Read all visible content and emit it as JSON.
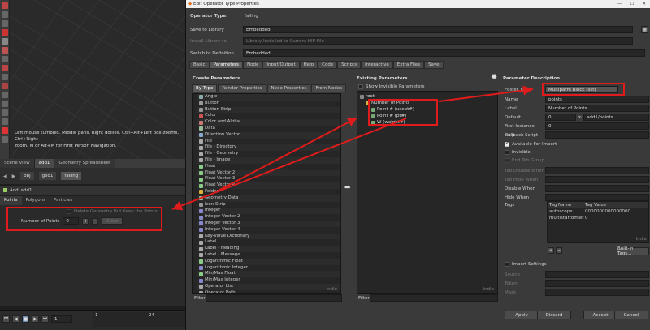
{
  "viewport": {
    "hint_lines": [
      "Left mouse tumbles. Middle pans. Right dollies. Ctrl+Alt+Left box-zooms. Ctrl+Right",
      "zoom.   M or Alt+M for First Person Navigation."
    ]
  },
  "pane_tabs": [
    {
      "label": "Scene View",
      "active": false
    },
    {
      "label": "add1",
      "active": true
    },
    {
      "label": "Geometry Spreadsheet",
      "active": false
    }
  ],
  "nav": {
    "path": [
      "obj",
      "geo1"
    ],
    "context": "falling"
  },
  "node_header": {
    "label": "Add",
    "name": "add1"
  },
  "param_tabs": [
    {
      "label": "Points",
      "active": true
    },
    {
      "label": "Polygons",
      "active": false
    },
    {
      "label": "Particles",
      "active": false
    }
  ],
  "node_params": {
    "delete_label": "Delete Geometry But Keep the Points",
    "num_points_label": "Number of Points",
    "num_points_value": "0",
    "clear_label": "Clear"
  },
  "timeline": {
    "frame": "1",
    "frame_end": "1",
    "tick_24": "24"
  },
  "dialog": {
    "title": "Edit Operator Type Properties",
    "operator_type_label": "Operator Type:",
    "operator_type_value": "falling",
    "save_to_library_label": "Save to Library",
    "save_to_library_value": "Embedded",
    "install_library_label": "Install Library to",
    "install_library_value": "Library Installed to Current HIP File",
    "switch_def_label": "Switch to Definition",
    "switch_def_value": "Embedded",
    "tabs": [
      {
        "label": "Basic",
        "active": false
      },
      {
        "label": "Parameters",
        "active": true
      },
      {
        "label": "Node",
        "active": false
      },
      {
        "label": "Input/Output",
        "active": false
      },
      {
        "label": "Help",
        "active": false
      },
      {
        "label": "Code",
        "active": false
      },
      {
        "label": "Scripts",
        "active": false
      },
      {
        "label": "Interactive",
        "active": false
      },
      {
        "label": "Extra Files",
        "active": false
      },
      {
        "label": "Save",
        "active": false
      }
    ],
    "create_params": {
      "heading": "Create Parameters",
      "subtabs": [
        "By Type",
        "Render Properties",
        "Node Properties",
        "From Nodes"
      ],
      "items": [
        "Angle",
        "Button",
        "Button Strip",
        "Color",
        "Color and Alpha",
        "Data",
        "Direction Vector",
        "File",
        "File - Directory",
        "File - Geometry",
        "File - Image",
        "Float",
        "Float Vector 2",
        "Float Vector 3",
        "Float Vector 4",
        "Folder",
        "Geometry Data",
        "Icon Strip",
        "Integer",
        "Integer Vector 2",
        "Integer Vector 3",
        "Integer Vector 4",
        "Key-Value Dictionary",
        "Label",
        "Label - Heading",
        "Label - Message",
        "Logarithmic Float",
        "Logarithmic Integer",
        "Min/Max Float",
        "Min/Max Integer",
        "Operator List",
        "Operator Path"
      ],
      "filter_label": "Filter",
      "indie": "Indie"
    },
    "existing_params": {
      "heading": "Existing Parameters",
      "show_invisible": "Show Invisible Parameters",
      "tree": [
        {
          "label": "root",
          "depth": 0
        },
        {
          "label": "Number of Points",
          "depth": 1
        },
        {
          "label": "Point # (usept#)",
          "depth": 2
        },
        {
          "label": "Point # (pt#)",
          "depth": 2
        },
        {
          "label": "W (weight#)",
          "depth": 2
        }
      ],
      "filter_label": "Filter",
      "indie": "Indie"
    },
    "param_desc": {
      "heading": "Parameter Description",
      "folder_type_label": "Folder Type",
      "folder_type_value": "Multiparm Block (list)",
      "name_label": "Name",
      "name_value": "points",
      "label_label": "Label",
      "label_value": "Number of Points",
      "default_label": "Default",
      "default_value": "0",
      "default_expr": "add1/points",
      "first_instance_label": "First Instance",
      "first_instance_value": "0",
      "help_label": "Help",
      "callback_label": "Callback Script",
      "available_import": "Available For Import",
      "invisible": "Invisible",
      "end_tab_group": "End Tab Group",
      "tab_disable_when": "Tab Disable When",
      "tab_hide_when": "Tab Hide When",
      "disable_when": "Disable When",
      "hide_when": "Hide When",
      "tags_label": "Tags",
      "tag_name_header": "Tag Name",
      "tag_value_header": "Tag Value",
      "tags": [
        {
          "name": "autoscope",
          "value": "0000000000000000"
        },
        {
          "name": "multistartoffset",
          "value": "0"
        }
      ],
      "built_in_tags": "Built-in Tags...",
      "import_settings": "Import Settings",
      "source": "Source",
      "token": "Token",
      "mask": "Mask",
      "indie": "Indie"
    },
    "buttons": {
      "apply": "Apply",
      "discard": "Discard",
      "accept": "Accept",
      "cancel": "Cancel"
    }
  },
  "colors": {
    "annotation_red": "#e01b1b",
    "folder_yellow": "#d9b33a",
    "accent_orange": "#e0a020"
  }
}
